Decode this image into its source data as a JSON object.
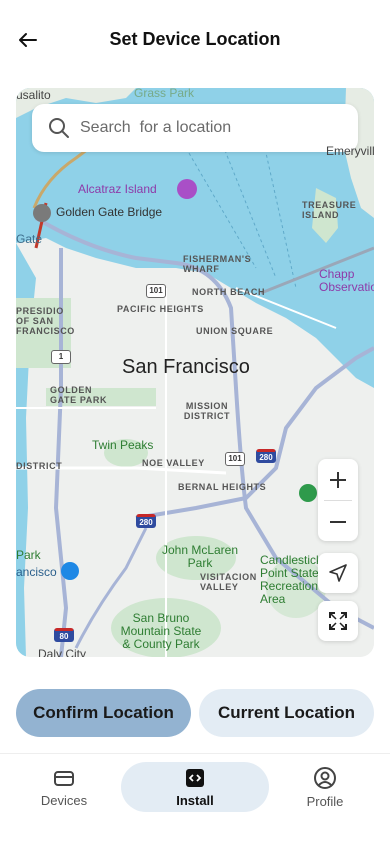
{
  "header": {
    "title": "Set Device Location"
  },
  "search": {
    "placeholder": "Search  for a location"
  },
  "map": {
    "city": "San Francisco",
    "places": {
      "alcatraz": "Alcatraz Island",
      "golden_gate_bridge": "Golden Gate Bridge",
      "fishermans_wharf": "Fisherman's Wharf",
      "north_beach": "North Beach",
      "pacific_heights": "Pacific Heights",
      "union_square": "Union Square",
      "presidio": "Presidio of San Francisco",
      "golden_gate_park": "Golden Gate Park",
      "mission_district": "Mission District",
      "twin_peaks": "Twin Peaks",
      "noe_valley": "Noe Valley",
      "bernal_heights": "Bernal Heights",
      "john_mclaren_park": "John McLaren Park",
      "visitacion_valley": "Visitacion Valley",
      "candlestick": "Candlestick Point State Recreation Area",
      "san_bruno": "San Bruno Mountain State & County Park",
      "treasure_island": "Treasure Island",
      "chapel_observatory": "Chapp Observatio",
      "emeryville": "Emeryville",
      "sausalito": "usalito",
      "grass_park": "Grass Park",
      "gate": "Gate",
      "district": "District",
      "park": "Park",
      "sco": "ancisco",
      "daly_city": "Daly City"
    },
    "routes": [
      "101",
      "1",
      "101",
      "280",
      "280",
      "80"
    ]
  },
  "actions": {
    "confirm": "Confirm Location",
    "current": "Current Location"
  },
  "nav": {
    "devices": "Devices",
    "install": "Install",
    "profile": "Profile"
  },
  "colors": {
    "confirm_bg": "#93b3d1",
    "current_bg": "#e3ecf4",
    "water": "#8fd1e8"
  }
}
